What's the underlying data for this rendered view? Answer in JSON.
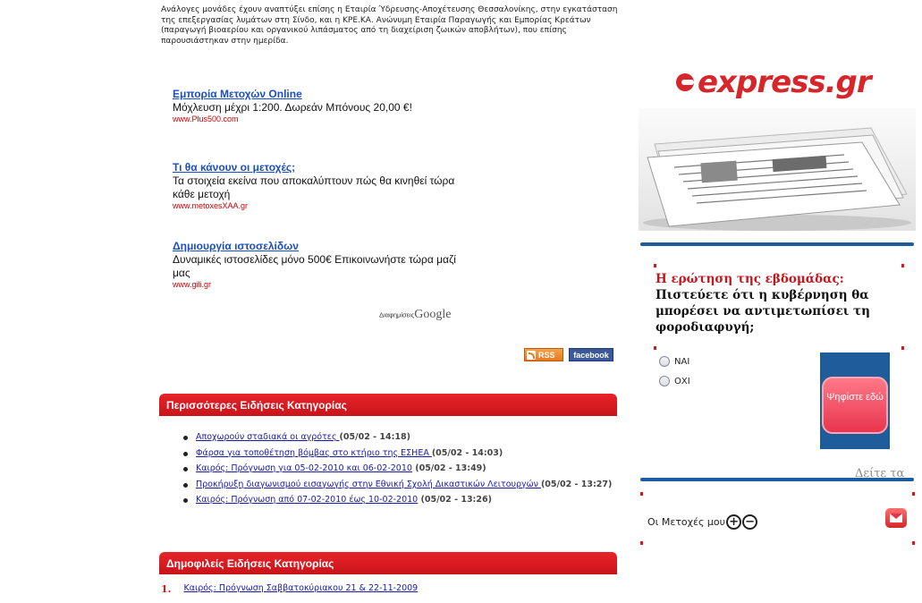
{
  "article": {
    "intro_text": "Ανάλογες μονάδες έχουν αναπτύξει επίσης η Εταιρία Ύδρευσης-Αποχέτευσης Θεσσαλονίκης, στην εγκατάσταση της επεξεργασίας λυμάτων στη Σίνδο, και η ΚΡΕ.ΚΑ. Ανώνυμη Εταιρία Παραγωγής και Εμπορίας Κρεάτων (παραγωγή βιοαερίου και οργανικού λιπάσματος από τη διαχείριση ζωικών αποβλήτων), που επίσης παρουσιάστηκαν στην ημερίδα."
  },
  "ads": [
    {
      "title": "Εμπορία Μετοχών Online",
      "body": "Μόχλευση μέχρι 1:200. Δωρεάν Μπόνους 20,00 €!",
      "url": "www.Plus500.com"
    },
    {
      "title": "Τι θα κάνουν οι μετοχές;",
      "body": "Τα στοιχεία εκείνα που αποκαλύπτουν πώς θα κινηθεί τώρα κάθε μετοχή",
      "url": "www.metoxesXAA.gr"
    },
    {
      "title": "Δημιουργία ιστοσελίδων",
      "body": "Δυναμικές ιστοσελίδες μόνο 500€ Επικοινωνήστε τώρα μαζί μας",
      "url": "www.gili.gr"
    }
  ],
  "ads_by": {
    "label": "Διαφημίσεις",
    "brand": "Google"
  },
  "badges": {
    "rss": "RSS",
    "facebook": "facebook"
  },
  "more_news": {
    "heading": "Περισσότερες Ειδήσεις Κατηγορίας",
    "items": [
      {
        "title": "Αποχωρούν σταδιακά οι αγρότες ",
        "date": "(05/02 - 14:18)"
      },
      {
        "title": "Φάρσα για τοποθέτηση βόμβας στο κτήριο της ΕΣΗΕΑ ",
        "date": "(05/02 - 14:03)"
      },
      {
        "title": "Καιρός: Πρόγνωση για 05-02-2010 και 06-02-2010",
        "date": " (05/02 - 13:49)"
      },
      {
        "title": "Προκήρυξη διαγωνισμού εισαγωγής στην Εθνική Σχολή Δικαστικών Λειτουργών ",
        "date": "(05/02 - 13:27)"
      },
      {
        "title": "Καιρός: Πρόγνωση από 07-02-2010 έως 10-02-2010",
        "date": " (05/02 - 13:26)"
      }
    ]
  },
  "popular_news": {
    "heading": "Δημοφιλείς Ειδήσεις Κατηγορίας",
    "items": [
      {
        "num": "1.",
        "title": "Καιρός: Πρόγνωση Σαββατοκύριακου 21 & 22-11-2009"
      }
    ]
  },
  "sidebar": {
    "logo_text": "express.gr",
    "poll": {
      "title": "Η ερώτηση της εβδομάδας:",
      "question": "Πιστεύετε ότι η κυβέρνηση θα μπορέσει να αντιμετωπίσει τη φοροδιαφυγή;",
      "options": [
        "ΝΑΙ",
        "ΟΧΙ"
      ],
      "vote_label": "Ψηφίστε εδώ",
      "results_label": "Δείτε τα"
    },
    "portfolio": {
      "label": "Οι Μετοχές μου",
      "add": "+",
      "remove": "−"
    }
  },
  "colors": {
    "accent_red": "#d6262a",
    "link_blue": "#1a4fc4",
    "rule_blue": "#1f5c9c"
  }
}
